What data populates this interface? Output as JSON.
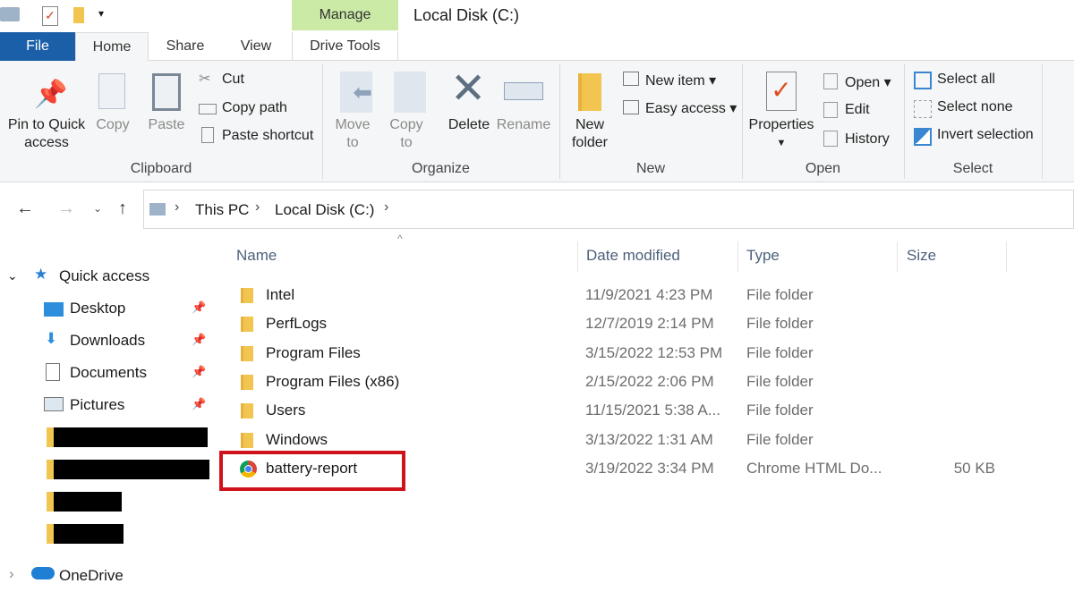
{
  "window": {
    "title": "Local Disk (C:)",
    "contextual_tab_group": "Manage"
  },
  "tabs": [
    {
      "label": "File"
    },
    {
      "label": "Home"
    },
    {
      "label": "Share"
    },
    {
      "label": "View"
    },
    {
      "label": "Drive Tools"
    }
  ],
  "ribbon": {
    "clipboard": {
      "pin": "Pin to Quick access",
      "pin1": "Pin to Quick",
      "pin2": "access",
      "copy": "Copy",
      "paste": "Paste",
      "cut": "Cut",
      "copy_path": "Copy path",
      "paste_shortcut": "Paste shortcut",
      "label": "Clipboard"
    },
    "organize": {
      "move1": "Move",
      "move2": "to",
      "copy1": "Copy",
      "copy2": "to",
      "delete": "Delete",
      "rename": "Rename",
      "label": "Organize"
    },
    "new": {
      "folder1": "New",
      "folder2": "folder",
      "new_item": "New item",
      "easy_access": "Easy access",
      "label": "New"
    },
    "open": {
      "properties": "Properties",
      "open": "Open",
      "edit": "Edit",
      "history": "History",
      "label": "Open"
    },
    "select": {
      "all": "Select all",
      "none": "Select none",
      "invert": "Invert selection",
      "label": "Select"
    }
  },
  "breadcrumb": [
    "This PC",
    "Local Disk (C:)"
  ],
  "nav": {
    "quick_access": "Quick access",
    "items": [
      {
        "label": "Desktop"
      },
      {
        "label": "Downloads"
      },
      {
        "label": "Documents"
      },
      {
        "label": "Pictures"
      }
    ],
    "onedrive": "OneDrive"
  },
  "columns": {
    "name": "Name",
    "date": "Date modified",
    "type": "Type",
    "size": "Size"
  },
  "files": [
    {
      "name": "Intel",
      "date": "11/9/2021 4:23 PM",
      "type": "File folder",
      "size": ""
    },
    {
      "name": "PerfLogs",
      "date": "12/7/2019 2:14 PM",
      "type": "File folder",
      "size": ""
    },
    {
      "name": "Program Files",
      "date": "3/15/2022 12:53 PM",
      "type": "File folder",
      "size": ""
    },
    {
      "name": "Program Files (x86)",
      "date": "2/15/2022 2:06 PM",
      "type": "File folder",
      "size": ""
    },
    {
      "name": "Users",
      "date": "11/15/2021 5:38 A...",
      "type": "File folder",
      "size": ""
    },
    {
      "name": "Windows",
      "date": "3/13/2022 1:31 AM",
      "type": "File folder",
      "size": ""
    },
    {
      "name": "battery-report",
      "date": "3/19/2022 3:34 PM",
      "type": "Chrome HTML Do...",
      "size": "50 KB"
    }
  ],
  "colors": {
    "file_tab": "#1a5fa8",
    "manage": "#cbeaa6",
    "highlight": "#d0121b"
  }
}
